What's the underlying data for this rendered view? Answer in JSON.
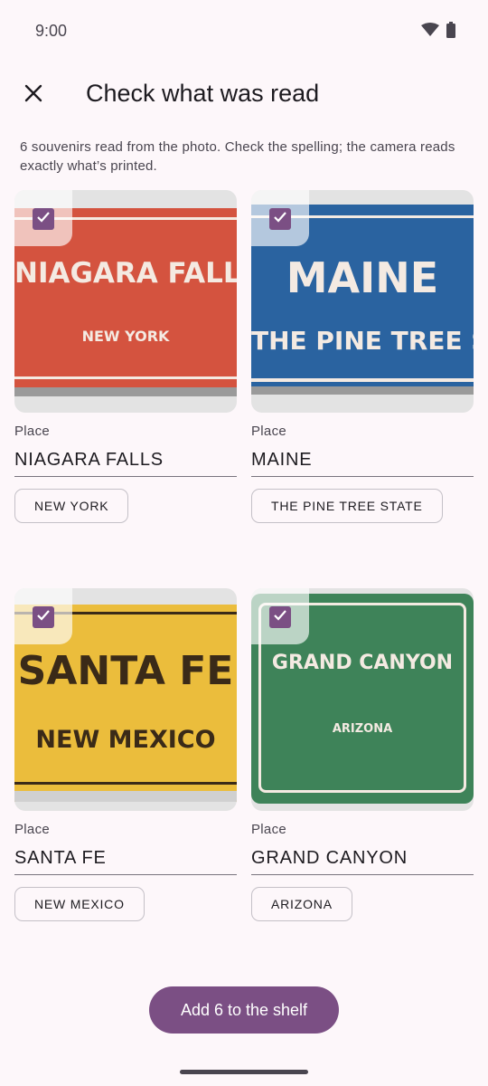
{
  "status_bar": {
    "time": "9:00",
    "icons": [
      "wifi-icon",
      "battery-icon"
    ]
  },
  "header": {
    "title": "Check what was read",
    "close_icon": "close-icon"
  },
  "description": "6 souvenirs read from the photo. Check the spelling; the camera reads exactly what’s printed.",
  "colors": {
    "accent": "#7b4f84",
    "background": "#fdf7fa"
  },
  "cards": [
    {
      "checked": true,
      "place_label": "Place",
      "place_value": "NIAGARA FALLS",
      "chip": "NEW YORK",
      "sign": {
        "main": "NIAGARA FALLS",
        "sub": "NEW YORK",
        "color": "#d4533f"
      }
    },
    {
      "checked": true,
      "place_label": "Place",
      "place_value": "MAINE",
      "chip": "THE PINE TREE STATE",
      "sign": {
        "main": "MAINE",
        "sub": "THE PINE TREE STATE",
        "color": "#2a63a0"
      }
    },
    {
      "checked": true,
      "place_label": "Place",
      "place_value": "SANTA FE",
      "chip": "NEW MEXICO",
      "sign": {
        "main": "SANTA FE",
        "sub": "NEW MEXICO",
        "color": "#ebbd3c"
      }
    },
    {
      "checked": true,
      "place_label": "Place",
      "place_value": "GRAND CANYON",
      "chip": "ARIZONA",
      "sign": {
        "main": "GRAND CANYON",
        "sub": "ARIZONA",
        "color": "#3e8359"
      }
    }
  ],
  "primary_action": {
    "label": "Add 6 to the shelf"
  }
}
